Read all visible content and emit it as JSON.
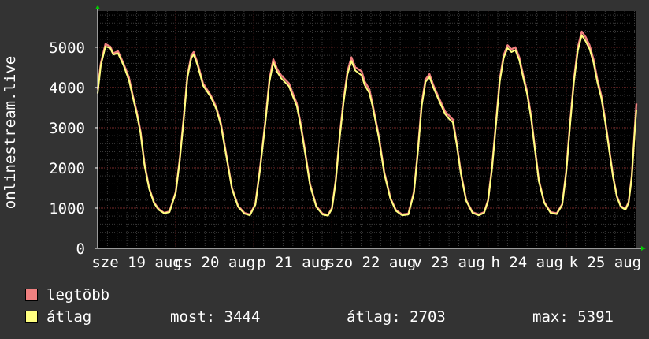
{
  "chart_data": {
    "type": "line",
    "ylabel": "onlinestream.live",
    "ylim": [
      0,
      5900
    ],
    "y_ticks": [
      0,
      1000,
      2000,
      3000,
      4000,
      5000
    ],
    "y_tick_labels": [
      "0",
      "1000",
      "2000",
      "3000",
      "4000",
      "5000"
    ],
    "x_tick_labels": [
      "sze 19 aug",
      "cs 20 aug",
      "p 21 aug",
      "szo 22 aug",
      "v 23 aug",
      "h 24 aug",
      "k 25 aug"
    ],
    "x_visible_labels": [
      "sze 19 aug",
      "cs 20 aug",
      "p 21 aug",
      "szo 22 aug",
      "v 23 aug",
      "h 24 aug",
      "k 25 aug"
    ],
    "x_days": 6.84,
    "series": [
      {
        "name": "legtöbb",
        "color": "#f08080",
        "points": [
          [
            0,
            3950
          ],
          [
            0.04,
            4600
          ],
          [
            0.1,
            5080
          ],
          [
            0.16,
            5020
          ],
          [
            0.2,
            4850
          ],
          [
            0.26,
            4900
          ],
          [
            0.33,
            4600
          ],
          [
            0.4,
            4250
          ],
          [
            0.45,
            3800
          ],
          [
            0.5,
            3400
          ],
          [
            0.55,
            2900
          ],
          [
            0.6,
            2100
          ],
          [
            0.66,
            1500
          ],
          [
            0.72,
            1150
          ],
          [
            0.78,
            980
          ],
          [
            0.85,
            880
          ],
          [
            0.92,
            920
          ],
          [
            1.0,
            1400
          ],
          [
            1.05,
            2200
          ],
          [
            1.1,
            3200
          ],
          [
            1.15,
            4300
          ],
          [
            1.2,
            4800
          ],
          [
            1.23,
            4880
          ],
          [
            1.28,
            4600
          ],
          [
            1.35,
            4100
          ],
          [
            1.45,
            3800
          ],
          [
            1.52,
            3500
          ],
          [
            1.58,
            3100
          ],
          [
            1.65,
            2300
          ],
          [
            1.72,
            1500
          ],
          [
            1.8,
            1050
          ],
          [
            1.88,
            880
          ],
          [
            1.95,
            840
          ],
          [
            2.02,
            1100
          ],
          [
            2.08,
            2000
          ],
          [
            2.15,
            3200
          ],
          [
            2.2,
            4200
          ],
          [
            2.25,
            4700
          ],
          [
            2.3,
            4450
          ],
          [
            2.35,
            4300
          ],
          [
            2.45,
            4100
          ],
          [
            2.5,
            3850
          ],
          [
            2.55,
            3600
          ],
          [
            2.6,
            3100
          ],
          [
            2.65,
            2500
          ],
          [
            2.72,
            1600
          ],
          [
            2.8,
            1050
          ],
          [
            2.88,
            860
          ],
          [
            2.95,
            830
          ],
          [
            3.0,
            1000
          ],
          [
            3.05,
            1700
          ],
          [
            3.1,
            2800
          ],
          [
            3.15,
            3700
          ],
          [
            3.2,
            4400
          ],
          [
            3.25,
            4750
          ],
          [
            3.3,
            4500
          ],
          [
            3.38,
            4400
          ],
          [
            3.42,
            4150
          ],
          [
            3.48,
            3950
          ],
          [
            3.52,
            3600
          ],
          [
            3.6,
            2800
          ],
          [
            3.67,
            1900
          ],
          [
            3.75,
            1250
          ],
          [
            3.82,
            950
          ],
          [
            3.9,
            840
          ],
          [
            3.98,
            860
          ],
          [
            4.05,
            1400
          ],
          [
            4.1,
            2400
          ],
          [
            4.15,
            3600
          ],
          [
            4.2,
            4200
          ],
          [
            4.25,
            4330
          ],
          [
            4.3,
            4050
          ],
          [
            4.38,
            3700
          ],
          [
            4.45,
            3400
          ],
          [
            4.5,
            3300
          ],
          [
            4.55,
            3200
          ],
          [
            4.6,
            2600
          ],
          [
            4.65,
            1900
          ],
          [
            4.72,
            1200
          ],
          [
            4.8,
            900
          ],
          [
            4.88,
            840
          ],
          [
            4.95,
            900
          ],
          [
            5.0,
            1200
          ],
          [
            5.05,
            2000
          ],
          [
            5.1,
            3100
          ],
          [
            5.15,
            4200
          ],
          [
            5.2,
            4800
          ],
          [
            5.25,
            5050
          ],
          [
            5.3,
            4950
          ],
          [
            5.35,
            5000
          ],
          [
            5.4,
            4750
          ],
          [
            5.45,
            4300
          ],
          [
            5.5,
            3900
          ],
          [
            5.55,
            3300
          ],
          [
            5.6,
            2500
          ],
          [
            5.65,
            1700
          ],
          [
            5.72,
            1150
          ],
          [
            5.8,
            900
          ],
          [
            5.88,
            870
          ],
          [
            5.95,
            1100
          ],
          [
            6.0,
            1900
          ],
          [
            6.05,
            3100
          ],
          [
            6.1,
            4200
          ],
          [
            6.15,
            5000
          ],
          [
            6.2,
            5391
          ],
          [
            6.25,
            5250
          ],
          [
            6.3,
            5050
          ],
          [
            6.35,
            4700
          ],
          [
            6.4,
            4200
          ],
          [
            6.45,
            3800
          ],
          [
            6.5,
            3200
          ],
          [
            6.55,
            2500
          ],
          [
            6.6,
            1800
          ],
          [
            6.65,
            1300
          ],
          [
            6.7,
            1050
          ],
          [
            6.76,
            980
          ],
          [
            6.8,
            1150
          ],
          [
            6.84,
            1800
          ],
          [
            6.88,
            3000
          ],
          [
            6.9,
            3600
          ]
        ]
      },
      {
        "name": "átlag",
        "color": "#ffff80",
        "points": [
          [
            0,
            3850
          ],
          [
            0.04,
            4550
          ],
          [
            0.1,
            5020
          ],
          [
            0.16,
            4980
          ],
          [
            0.2,
            4820
          ],
          [
            0.26,
            4850
          ],
          [
            0.33,
            4560
          ],
          [
            0.4,
            4180
          ],
          [
            0.45,
            3760
          ],
          [
            0.5,
            3350
          ],
          [
            0.55,
            2850
          ],
          [
            0.6,
            2060
          ],
          [
            0.66,
            1480
          ],
          [
            0.72,
            1130
          ],
          [
            0.78,
            960
          ],
          [
            0.85,
            870
          ],
          [
            0.92,
            900
          ],
          [
            1.0,
            1380
          ],
          [
            1.05,
            2160
          ],
          [
            1.1,
            3150
          ],
          [
            1.15,
            4250
          ],
          [
            1.2,
            4740
          ],
          [
            1.23,
            4820
          ],
          [
            1.28,
            4550
          ],
          [
            1.35,
            4050
          ],
          [
            1.45,
            3760
          ],
          [
            1.52,
            3460
          ],
          [
            1.58,
            3050
          ],
          [
            1.65,
            2260
          ],
          [
            1.72,
            1480
          ],
          [
            1.8,
            1030
          ],
          [
            1.88,
            860
          ],
          [
            1.95,
            820
          ],
          [
            2.02,
            1080
          ],
          [
            2.08,
            1960
          ],
          [
            2.15,
            3150
          ],
          [
            2.2,
            4140
          ],
          [
            2.25,
            4620
          ],
          [
            2.3,
            4380
          ],
          [
            2.35,
            4230
          ],
          [
            2.45,
            4030
          ],
          [
            2.5,
            3780
          ],
          [
            2.55,
            3540
          ],
          [
            2.6,
            3050
          ],
          [
            2.65,
            2450
          ],
          [
            2.72,
            1570
          ],
          [
            2.8,
            1030
          ],
          [
            2.88,
            840
          ],
          [
            2.95,
            810
          ],
          [
            3.0,
            980
          ],
          [
            3.05,
            1670
          ],
          [
            3.1,
            2750
          ],
          [
            3.15,
            3640
          ],
          [
            3.2,
            4330
          ],
          [
            3.25,
            4660
          ],
          [
            3.3,
            4420
          ],
          [
            3.38,
            4300
          ],
          [
            3.42,
            4060
          ],
          [
            3.48,
            3860
          ],
          [
            3.52,
            3540
          ],
          [
            3.6,
            2750
          ],
          [
            3.67,
            1860
          ],
          [
            3.75,
            1230
          ],
          [
            3.82,
            930
          ],
          [
            3.9,
            820
          ],
          [
            3.98,
            840
          ],
          [
            4.05,
            1370
          ],
          [
            4.1,
            2360
          ],
          [
            4.15,
            3540
          ],
          [
            4.2,
            4140
          ],
          [
            4.25,
            4260
          ],
          [
            4.3,
            3990
          ],
          [
            4.38,
            3640
          ],
          [
            4.45,
            3340
          ],
          [
            4.5,
            3220
          ],
          [
            4.55,
            3130
          ],
          [
            4.6,
            2560
          ],
          [
            4.65,
            1860
          ],
          [
            4.72,
            1180
          ],
          [
            4.8,
            880
          ],
          [
            4.88,
            820
          ],
          [
            4.95,
            880
          ],
          [
            5.0,
            1180
          ],
          [
            5.05,
            1960
          ],
          [
            5.1,
            3050
          ],
          [
            5.15,
            4140
          ],
          [
            5.2,
            4740
          ],
          [
            5.25,
            4980
          ],
          [
            5.3,
            4880
          ],
          [
            5.35,
            4930
          ],
          [
            5.4,
            4680
          ],
          [
            5.45,
            4240
          ],
          [
            5.5,
            3840
          ],
          [
            5.55,
            3250
          ],
          [
            5.6,
            2460
          ],
          [
            5.65,
            1670
          ],
          [
            5.72,
            1130
          ],
          [
            5.8,
            880
          ],
          [
            5.88,
            850
          ],
          [
            5.95,
            1080
          ],
          [
            6.0,
            1860
          ],
          [
            6.05,
            3050
          ],
          [
            6.1,
            4140
          ],
          [
            6.15,
            4920
          ],
          [
            6.2,
            5300
          ],
          [
            6.25,
            5150
          ],
          [
            6.3,
            4960
          ],
          [
            6.35,
            4620
          ],
          [
            6.4,
            4130
          ],
          [
            6.45,
            3740
          ],
          [
            6.5,
            3150
          ],
          [
            6.55,
            2460
          ],
          [
            6.6,
            1770
          ],
          [
            6.65,
            1280
          ],
          [
            6.7,
            1030
          ],
          [
            6.76,
            960
          ],
          [
            6.8,
            1130
          ],
          [
            6.84,
            1770
          ],
          [
            6.88,
            2950
          ],
          [
            6.9,
            3444
          ]
        ]
      }
    ]
  },
  "legend": {
    "items": [
      {
        "label": "legtöbb",
        "color": "#f08080"
      },
      {
        "label": "átlag",
        "color": "#ffff80"
      }
    ],
    "stats": {
      "now": "most: 3444",
      "avg": "átlag: 2703",
      "max": "max: 5391"
    }
  }
}
